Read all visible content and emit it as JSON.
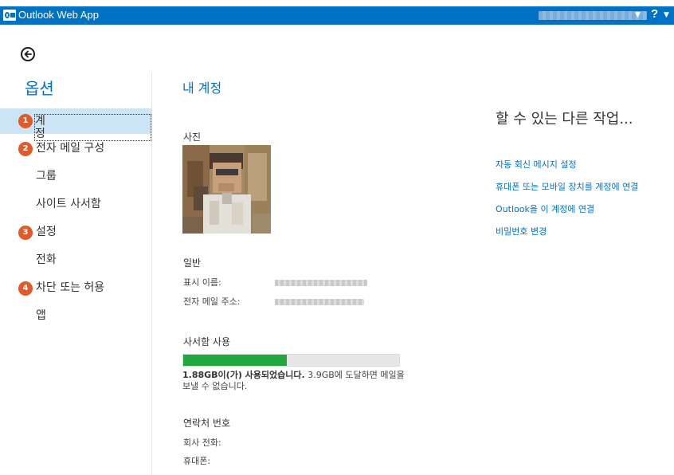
{
  "app": {
    "title": "Outlook Web App",
    "logo_icon": "outlook-logo-icon",
    "accent_color": "#0072c6"
  },
  "header": {
    "help_label": "?",
    "help_icon": "help-icon",
    "user_menu_icon": "chevron-down-icon"
  },
  "navigation": {
    "back_icon": "back-arrow-icon",
    "heading": "옵션",
    "items": [
      {
        "label": "계정",
        "badge": "1",
        "selected": true
      },
      {
        "label": "전자 메일 구성",
        "badge": "2",
        "selected": false
      },
      {
        "label": "그룹",
        "badge": "",
        "selected": false
      },
      {
        "label": "사이트 사서함",
        "badge": "",
        "selected": false
      },
      {
        "label": "설정",
        "badge": "3",
        "selected": false
      },
      {
        "label": "전화",
        "badge": "",
        "selected": false
      },
      {
        "label": "차단 또는 허용",
        "badge": "4",
        "selected": false
      },
      {
        "label": "앱",
        "badge": "",
        "selected": false
      }
    ],
    "badge_color": "#e05a2c",
    "selected_color": "#cde6f7"
  },
  "account": {
    "title": "내 계정",
    "photo_label": "사진",
    "general_label": "일반",
    "display_name_label": "표시 이름:",
    "email_label": "전자 메일 주소:",
    "mailbox_usage_label": "사서함 사용",
    "usage": {
      "fraction": 0.48,
      "used_text": "1.88GB이(가) 사용되었습니다.",
      "limit_text": " 3.9GB에 도달하면 메일을 보낼 수 없습니다.",
      "bar_color": "#22a63e"
    },
    "contact_label": "연락처 번호",
    "work_phone_label": "회사 전화:",
    "mobile_label": "휴대폰:"
  },
  "side_panel": {
    "heading": "할 수 있는 다른 작업...",
    "links": [
      "자동 회신 메시지 설정",
      "휴대폰 또는 모바일 장치를 계정에 연결",
      "Outlook을 이 계정에 연결",
      "비밀번호 변경"
    ]
  }
}
